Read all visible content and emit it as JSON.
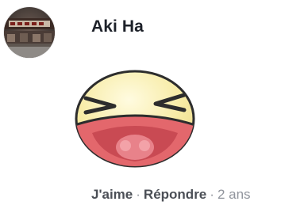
{
  "comment": {
    "author_name": "Aki Ha",
    "actions": {
      "like_label": "J'aime",
      "separator": "·",
      "reply_label": "Répondre",
      "timestamp": "2 ans"
    },
    "avatar_icon": "profile-photo",
    "sticker_icon": "laughing-face-sticker"
  },
  "colors": {
    "author_text": "#1d2129",
    "action_link": "#4b4f56",
    "meta_text": "#90949c"
  }
}
